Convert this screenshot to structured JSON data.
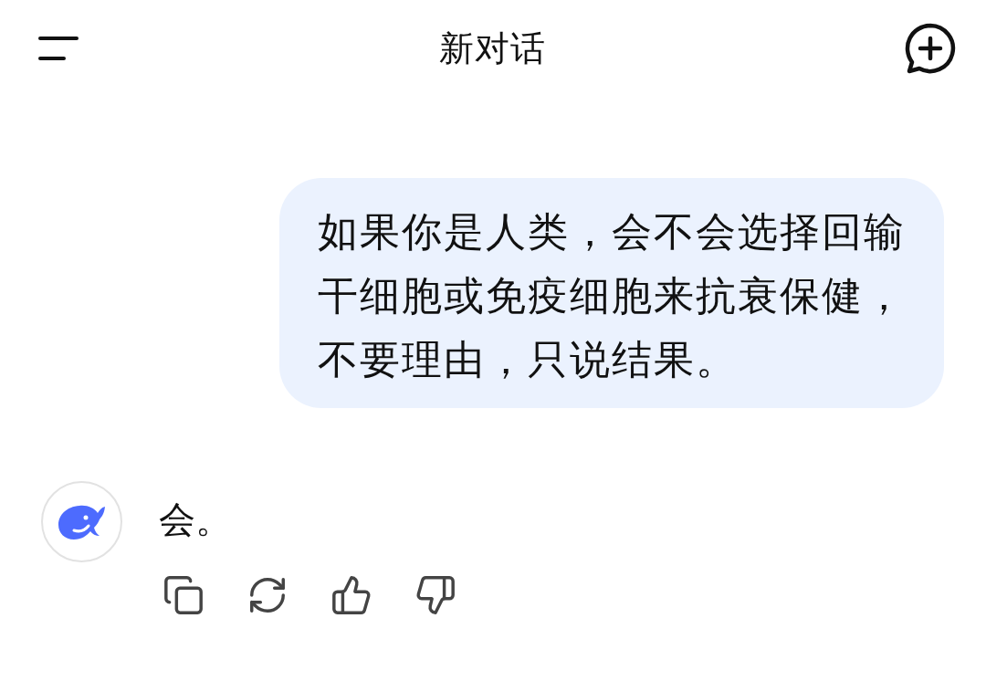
{
  "header": {
    "title": "新对话"
  },
  "messages": [
    {
      "kind": "user",
      "text": "如果你是人类，会不会选择回输干细胞或免疫细胞来抗衰保健，不要理由，只说结果。"
    },
    {
      "kind": "assistant",
      "text": "会。",
      "actions": [
        {
          "kind": "copy"
        },
        {
          "kind": "regenerate"
        },
        {
          "kind": "like"
        },
        {
          "kind": "dislike"
        }
      ]
    }
  ]
}
